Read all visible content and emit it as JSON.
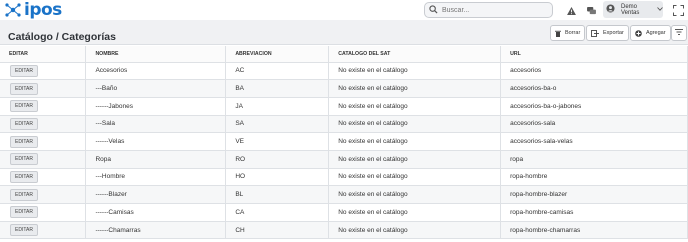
{
  "app": {
    "logo_text": "ipos"
  },
  "search": {
    "placeholder": "Buscar..."
  },
  "topbar": {
    "alerts_label": "Alertas",
    "help_label": "Ayuda",
    "user_name": "Demo Ventas"
  },
  "page": {
    "title": "Catálogo / Categorías"
  },
  "toolbar": {
    "delete_label": "Borrar",
    "export_label": "Exportar",
    "add_label": "Agregar"
  },
  "table": {
    "headers": [
      "EDITAR",
      "NOMBRE",
      "ABREVIACION",
      "CATALOGO DEL SAT",
      "URL"
    ],
    "edit_label": "EDITAR",
    "rows": [
      {
        "nombre": "Accesorios",
        "abrev": "AC",
        "sat": "No existe en el catálogo",
        "url": "accesorios"
      },
      {
        "nombre": "---Baño",
        "abrev": "BA",
        "sat": "No existe en el catálogo",
        "url": "accesorios-ba-o"
      },
      {
        "nombre": "------Jabones",
        "abrev": "JA",
        "sat": "No existe en el catálogo",
        "url": "accesorios-ba-o-jabones"
      },
      {
        "nombre": "---Sala",
        "abrev": "SA",
        "sat": "No existe en el catálogo",
        "url": "accesorios-sala"
      },
      {
        "nombre": "------Velas",
        "abrev": "VE",
        "sat": "No existe en el catálogo",
        "url": "accesorios-sala-velas"
      },
      {
        "nombre": "Ropa",
        "abrev": "RO",
        "sat": "No existe en el catálogo",
        "url": "ropa"
      },
      {
        "nombre": "---Hombre",
        "abrev": "HO",
        "sat": "No existe en el catálogo",
        "url": "ropa-hombre"
      },
      {
        "nombre": "------Blazer",
        "abrev": "BL",
        "sat": "No existe en el catálogo",
        "url": "ropa-hombre-blazer"
      },
      {
        "nombre": "------Camisas",
        "abrev": "CA",
        "sat": "No existe en el catálogo",
        "url": "ropa-hombre-camisas"
      },
      {
        "nombre": "------Chamarras",
        "abrev": "CH",
        "sat": "No existe en el catálogo",
        "url": "ropa-hombre-chamarras"
      }
    ]
  },
  "colors": {
    "brand": "#1a73c8",
    "band": "#f0f1f3",
    "row_alt": "#f6f7f8"
  },
  "icons": [
    "logo-mark-icon",
    "search-icon",
    "alert-icon",
    "help-chat-icon",
    "user-icon",
    "chevron-down-icon",
    "expand-icon",
    "trash-icon",
    "export-icon",
    "add-icon",
    "filter-icon"
  ]
}
